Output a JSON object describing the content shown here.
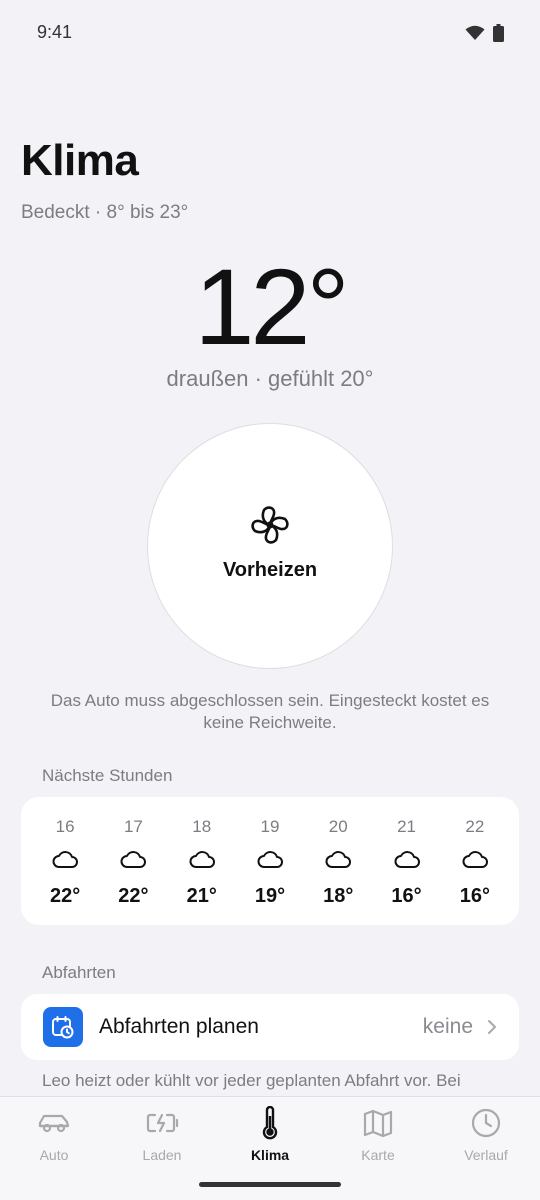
{
  "status": {
    "time": "9:41"
  },
  "header": {
    "title": "Klima",
    "subtitle": "Bedeckt · 8° bis 23°"
  },
  "current": {
    "temperature": "12°",
    "detail": "draußen · gefühlt 20°"
  },
  "preheat": {
    "label": "Vorheizen",
    "icon": "fan-icon"
  },
  "note": "Das Auto muss abgeschlossen sein. Eingesteckt kostet es keine Reichweite.",
  "forecast": {
    "section_label": "Nächste Stunden",
    "hours": [
      {
        "time": "16",
        "icon": "cloud-icon",
        "temp": "22°"
      },
      {
        "time": "17",
        "icon": "cloud-icon",
        "temp": "22°"
      },
      {
        "time": "18",
        "icon": "cloud-icon",
        "temp": "21°"
      },
      {
        "time": "19",
        "icon": "cloud-icon",
        "temp": "19°"
      },
      {
        "time": "20",
        "icon": "cloud-icon",
        "temp": "18°"
      },
      {
        "time": "21",
        "icon": "cloud-icon",
        "temp": "16°"
      },
      {
        "time": "22",
        "icon": "cloud-icon",
        "temp": "16°"
      }
    ]
  },
  "departures": {
    "section_label": "Abfahrten",
    "row_label": "Abfahrten planen",
    "row_value": "keine",
    "footnote": "Leo heizt oder kühlt vor jeder geplanten Abfahrt vor. Bei",
    "accent": "#1e6fe8"
  },
  "tabs": [
    {
      "label": "Auto",
      "icon": "car-icon",
      "active": false
    },
    {
      "label": "Laden",
      "icon": "battery-charging-icon",
      "active": false
    },
    {
      "label": "Klima",
      "icon": "thermometer-icon",
      "active": true
    },
    {
      "label": "Karte",
      "icon": "map-icon",
      "active": false
    },
    {
      "label": "Verlauf",
      "icon": "clock-icon",
      "active": false
    }
  ]
}
